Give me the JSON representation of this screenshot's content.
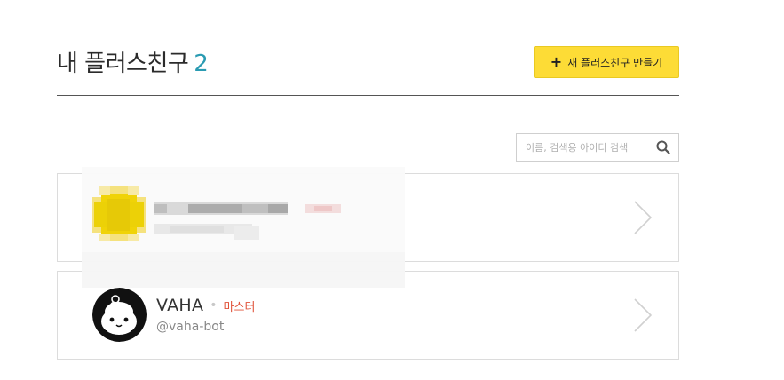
{
  "header": {
    "title": "내 플러스친구",
    "count": "2",
    "create_button_label": "새 플러스친구 만들기"
  },
  "search": {
    "placeholder": "이름, 검색용 아이디 검색"
  },
  "friends": [
    {
      "name": "",
      "role": "",
      "id": "",
      "avatar_color": "#f2d400"
    },
    {
      "name": "VAHA",
      "role": "마스터",
      "id": "@vaha-bot",
      "avatar_color": "#111111"
    }
  ],
  "colors": {
    "accent_count": "#2a9bb2",
    "button_yellow": "#fddc36",
    "role_red": "#e0533a"
  },
  "icons": {
    "create": "plus-icon",
    "search": "search-icon",
    "row_arrow": "chevron-right-icon"
  }
}
